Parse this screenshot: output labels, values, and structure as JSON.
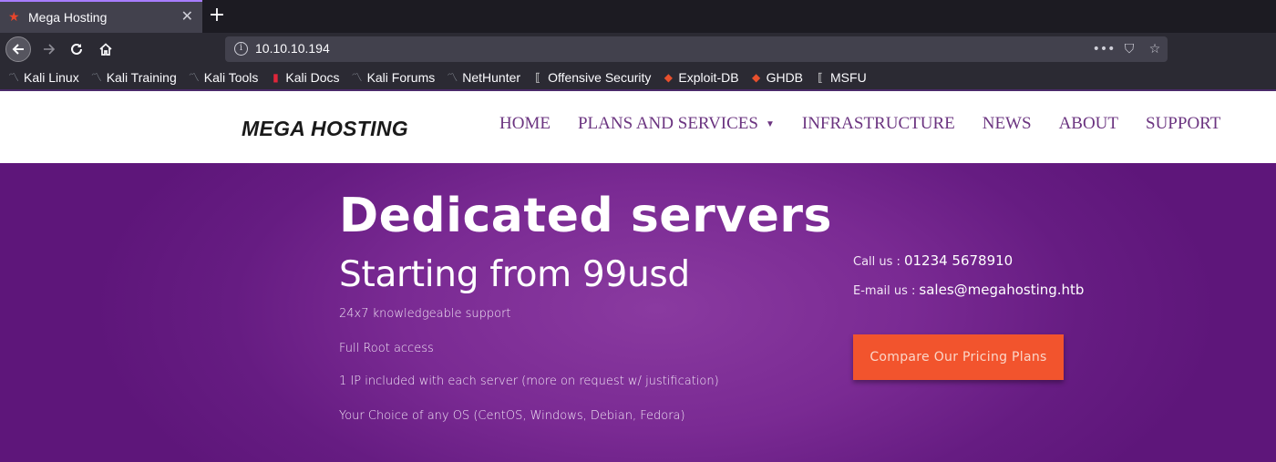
{
  "browser": {
    "tab_title": "Mega Hosting",
    "tab_close": "✕",
    "new_tab": "+",
    "url": "10.10.10.194",
    "url_actions": [
      "•••",
      "⛉",
      "☆"
    ],
    "bookmarks": [
      {
        "label": "Kali Linux",
        "icon": "kali-dragon-icon"
      },
      {
        "label": "Kali Training",
        "icon": "kali-dragon-icon"
      },
      {
        "label": "Kali Tools",
        "icon": "kali-dragon-icon"
      },
      {
        "label": "Kali Docs",
        "icon": "kali-docs-icon"
      },
      {
        "label": "Kali Forums",
        "icon": "kali-dragon-icon"
      },
      {
        "label": "NetHunter",
        "icon": "kali-dragon-icon"
      },
      {
        "label": "Offensive Security",
        "icon": "offsec-icon"
      },
      {
        "label": "Exploit-DB",
        "icon": "exploit-db-icon"
      },
      {
        "label": "GHDB",
        "icon": "exploit-db-icon"
      },
      {
        "label": "MSFU",
        "icon": "offsec-icon"
      }
    ]
  },
  "site": {
    "logo": "MEGA HOSTING",
    "menu": [
      "HOME",
      "PLANS AND SERVICES",
      "INFRASTRUCTURE",
      "NEWS",
      "ABOUT",
      "SUPPORT"
    ],
    "menu_caret": "▼"
  },
  "hero": {
    "title": "Dedicated servers",
    "subtitle": "Starting from 99usd",
    "features": [
      "24x7 knowledgeable support",
      "Full Root access",
      "1 IP included with each server (more on request w/ justification)",
      "Your Choice of any OS (CentOS, Windows, Debian, Fedora)"
    ],
    "call_label": "Call us :",
    "call_value": "01234 5678910",
    "email_label": "E-mail us :",
    "email_value": "sales@megahosting.htb",
    "cta": "Compare Our Pricing Plans"
  },
  "colors": {
    "accent": "#f2542d",
    "hero_bg": "#7a2a93",
    "menu_text": "#6b3480"
  }
}
